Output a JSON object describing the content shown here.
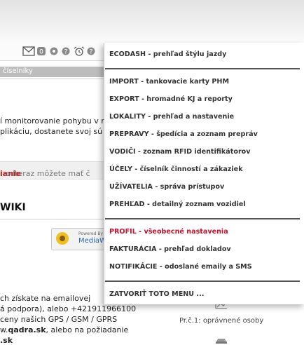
{
  "left_panel": {
    "section_label": "číselníky",
    "paragraph_lines": [
      "í monitorovanie pohybu v re",
      "plikáciu, dostanete svoj sú"
    ],
    "notice_red": "ianie",
    "notice_rest": " - odteraz môžete mať č",
    "wiki_heading": "WIKI",
    "badge_powered": "Powered By",
    "badge_name": "MediaW",
    "contact_lines": [
      "ch získate na emailovej",
      "á podpora), alebo +421911966100",
      "ceny našich GPS / GSM / GPRS"
    ],
    "contact_www_pre": "w.",
    "contact_www_bold": "qadra.sk",
    "contact_www_post": ", alebo na požiadanie",
    "contact_sk": ".sk",
    "caption": "Pr.č.1: oprávnené osoby"
  },
  "menu": {
    "items": [
      {
        "label": "ECODASH - prehľad štýlu jazdy"
      },
      {
        "label": "IMPORT - tankovacie karty PHM"
      },
      {
        "label": "EXPORT - hromadné KJ a reporty"
      },
      {
        "label": "LOKALITY - prehľad a nastavenie"
      },
      {
        "label": "PREPRAVY - špedícia a zoznam prepráv"
      },
      {
        "label": "VODIČI - zoznam RFID identifikátorov"
      },
      {
        "label": "ÚČELY - číselník činností a zákaziek"
      },
      {
        "label": "UŽÍVATELIA - správa prístupov"
      },
      {
        "label": "PREHĽAD - detailný zoznam vozidiel"
      },
      {
        "label": "PROFIL - všeobecné nastavenia",
        "active": true
      },
      {
        "label": "FAKTURÁCIA - prehľad dokladov"
      },
      {
        "label": "NOTIFIKÁCIE - odoslané emaily a SMS"
      },
      {
        "label": "ZATVORIŤ TOTO MENU ..."
      }
    ],
    "active_color": "#c8102e"
  },
  "toolbar": {
    "icons": [
      "mail-icon",
      "notification-badge-icon",
      "settings-icon",
      "help-icon",
      "alarm-icon",
      "help-icon"
    ]
  }
}
